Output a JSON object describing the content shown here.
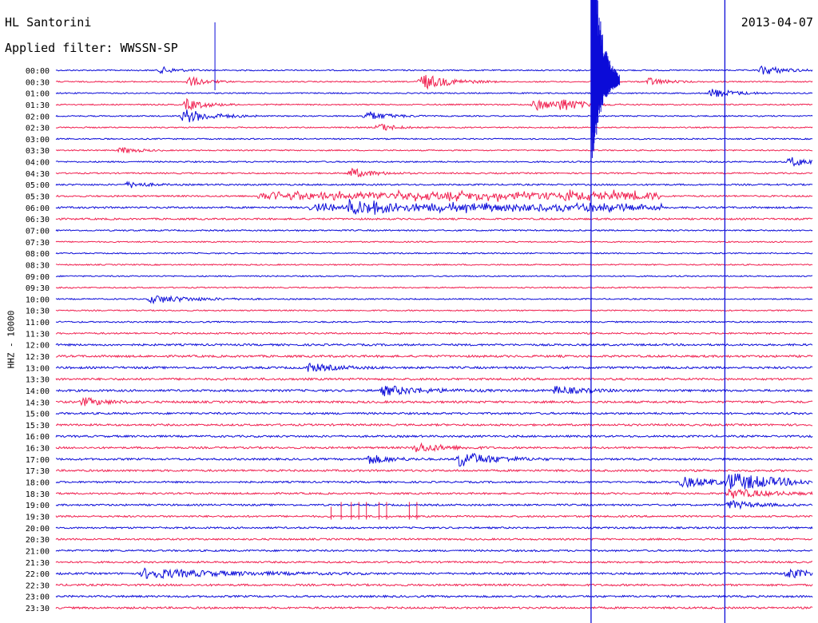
{
  "header": {
    "station": "HL Santorini",
    "date": "2013-04-07",
    "filter": "Applied filter: WWSSN-SP"
  },
  "channel_label": "HHZ - 10000",
  "colors": {
    "trace_a": "#0b0bd8",
    "trace_b": "#f01f4f",
    "background": "#ffffff",
    "text": "#000000"
  },
  "chart_data": {
    "type": "line",
    "title": "HL Santorini",
    "subtitle": "Applied filter: WWSSN-SP",
    "ylabel": "HHZ - 10000",
    "xlabel": "",
    "grid": false,
    "legend": "none",
    "row_labels": [
      "00:00",
      "00:30",
      "01:00",
      "01:30",
      "02:00",
      "02:30",
      "03:00",
      "03:30",
      "04:00",
      "04:30",
      "05:00",
      "05:30",
      "06:00",
      "06:30",
      "07:00",
      "07:30",
      "08:00",
      "08:30",
      "09:00",
      "09:30",
      "10:00",
      "10:30",
      "11:00",
      "11:30",
      "12:00",
      "12:30",
      "13:00",
      "13:30",
      "14:00",
      "14:30",
      "15:00",
      "15:30",
      "16:00",
      "16:30",
      "17:00",
      "17:30",
      "18:00",
      "18:30",
      "19:00",
      "19:30",
      "20:00",
      "20:30",
      "21:00",
      "21:30",
      "22:00",
      "22:30",
      "23:00",
      "23:30"
    ],
    "row_minutes": 30,
    "noise_level": [
      0.35,
      0.35,
      0.35,
      0.35,
      0.35,
      0.35,
      0.35,
      0.35,
      0.4,
      0.4,
      0.45,
      0.45,
      0.5,
      0.5,
      0.4,
      0.35,
      0.35,
      0.35,
      0.35,
      0.35,
      0.35,
      0.35,
      0.4,
      0.45,
      0.55,
      0.6,
      0.6,
      0.6,
      0.6,
      0.6,
      0.55,
      0.55,
      0.55,
      0.55,
      0.55,
      0.55,
      0.5,
      0.5,
      0.5,
      0.5,
      0.5,
      0.5,
      0.5,
      0.5,
      0.55,
      0.55,
      0.55,
      0.55
    ],
    "events": [
      {
        "row": 0,
        "minute": 4.2,
        "amp": 4,
        "dur": 0.6
      },
      {
        "row": 0,
        "minute": 28,
        "amp": 6,
        "dur": 0.8
      },
      {
        "row": 1,
        "minute": 5.3,
        "amp": 6,
        "dur": 0.6
      },
      {
        "row": 1,
        "minute": 14.5,
        "amp": 10,
        "dur": 1.0
      },
      {
        "row": 1,
        "minute": 23.5,
        "amp": 5,
        "dur": 0.6
      },
      {
        "row": 2,
        "minute": 26,
        "amp": 6,
        "dur": 0.8
      },
      {
        "row": 3,
        "minute": 5.2,
        "amp": 7,
        "dur": 0.7
      },
      {
        "row": 3,
        "minute": 19,
        "amp": 7,
        "dur": 0.8
      },
      {
        "row": 3,
        "minute": 20,
        "amp": 7,
        "dur": 0.8
      },
      {
        "row": 4,
        "minute": 5.1,
        "amp": 9,
        "dur": 1.0
      },
      {
        "row": 4,
        "minute": 12.3,
        "amp": 6,
        "dur": 0.8
      },
      {
        "row": 5,
        "minute": 12.8,
        "amp": 5,
        "dur": 0.6
      },
      {
        "row": 7,
        "minute": 2.6,
        "amp": 4,
        "dur": 0.6
      },
      {
        "row": 8,
        "minute": 29.1,
        "amp": 6,
        "dur": 0.8
      },
      {
        "row": 9,
        "minute": 11.7,
        "amp": 6,
        "dur": 0.8
      },
      {
        "row": 10,
        "minute": 2.9,
        "amp": 4,
        "dur": 0.6
      },
      {
        "row": 12,
        "minute": 11.7,
        "amp": 6,
        "dur": 1.2
      },
      {
        "row": 20,
        "minute": 3.8,
        "amp": 5,
        "dur": 1.5
      },
      {
        "row": 26,
        "minute": 10,
        "amp": 5,
        "dur": 1.0
      },
      {
        "row": 28,
        "minute": 13,
        "amp": 6,
        "dur": 1.5
      },
      {
        "row": 28,
        "minute": 19.8,
        "amp": 5,
        "dur": 1.0
      },
      {
        "row": 29,
        "minute": 1.1,
        "amp": 5,
        "dur": 0.8
      },
      {
        "row": 33,
        "minute": 14.3,
        "amp": 6,
        "dur": 1.0
      },
      {
        "row": 34,
        "minute": 16.0,
        "amp": 10,
        "dur": 1.2
      },
      {
        "row": 34,
        "minute": 12.4,
        "amp": 6,
        "dur": 0.8
      },
      {
        "row": 36,
        "minute": 24.8,
        "amp": 6,
        "dur": 1.5
      },
      {
        "row": 36,
        "minute": 26.7,
        "amp": 10,
        "dur": 2.0
      },
      {
        "row": 37,
        "minute": 26.7,
        "amp": 6,
        "dur": 1.5
      },
      {
        "row": 38,
        "minute": 26.7,
        "amp": 5,
        "dur": 1.0
      },
      {
        "row": 44,
        "minute": 3.5,
        "amp": 6,
        "dur": 3.0
      },
      {
        "row": 44,
        "minute": 29,
        "amp": 6,
        "dur": 0.8
      }
    ],
    "swarms": [
      {
        "row": 11,
        "start": 8,
        "end": 24,
        "amp": 8
      },
      {
        "row": 12,
        "start": 10,
        "end": 24,
        "amp": 7
      }
    ],
    "spikes": [
      {
        "row": 0,
        "minute": 6.3,
        "amp": 60
      },
      {
        "row": 1,
        "minute": 21.3,
        "amp": 80,
        "down": 10
      },
      {
        "row": 2,
        "minute": 21.3,
        "amp": 50
      }
    ],
    "sharp_marks": [
      {
        "row": 39,
        "minute": 11.3,
        "amp": 18
      },
      {
        "row": 39,
        "minute": 11.7,
        "amp": 18
      },
      {
        "row": 39,
        "minute": 12.0,
        "amp": 18
      },
      {
        "row": 39,
        "minute": 12.3,
        "amp": 18
      },
      {
        "row": 39,
        "minute": 12.8,
        "amp": 18
      },
      {
        "row": 39,
        "minute": 13.1,
        "amp": 18
      },
      {
        "row": 39,
        "minute": 14.0,
        "amp": 18
      },
      {
        "row": 39,
        "minute": 14.3,
        "amp": 18
      },
      {
        "row": 39,
        "minute": 10.9,
        "amp": 12
      }
    ],
    "vertical_lines": [
      {
        "minute": 21.2,
        "color": "trace_a"
      },
      {
        "minute": 26.5,
        "color": "trace_a"
      }
    ],
    "big_event": {
      "row": 1,
      "minute": 21.2,
      "amp": 250
    }
  }
}
